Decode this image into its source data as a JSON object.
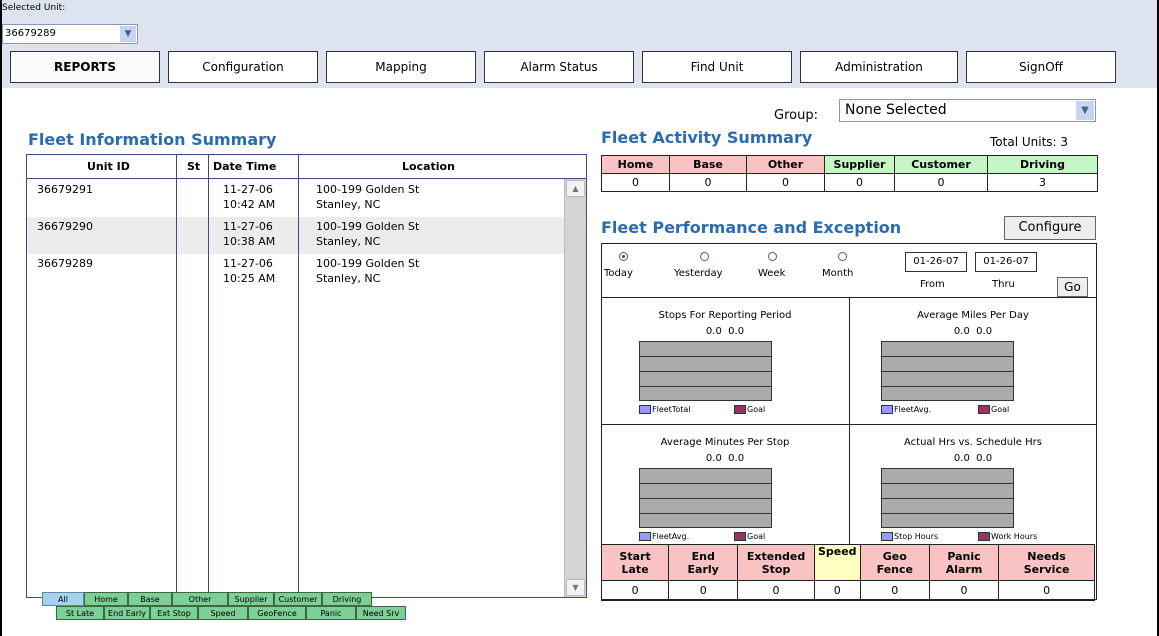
{
  "header": {
    "selected_unit_label": "Selected Unit:",
    "selected_unit_value": "36679289",
    "nav_tabs": [
      "REPORTS",
      "Configuration",
      "Mapping",
      "Alarm Status",
      "Find Unit",
      "Administration",
      "SignOff"
    ],
    "active_tab": "REPORTS"
  },
  "fleet_info": {
    "title": "Fleet Information Summary",
    "columns": [
      "Unit ID",
      "St",
      "Date Time",
      "Location"
    ],
    "rows": [
      {
        "unit_id": "36679291",
        "st": "",
        "date": "11-27-06",
        "time": "10:42 AM",
        "location_1": "100-199 Golden St",
        "location_2": "Stanley, NC"
      },
      {
        "unit_id": "36679290",
        "st": "",
        "date": "11-27-06",
        "time": "10:38 AM",
        "location_1": "100-199 Golden St",
        "location_2": "Stanley, NC"
      },
      {
        "unit_id": "36679289",
        "st": "",
        "date": "11-27-06",
        "time": "10:25 AM",
        "location_1": "100-199 Golden St",
        "location_2": "Stanley, NC"
      }
    ],
    "filter_tabs_row1": [
      "All",
      "Home",
      "Base",
      "Other",
      "Supplier",
      "Customer",
      "Driving"
    ],
    "filter_tabs_row2": [
      "St Late",
      "End Early",
      "Ext Stop",
      "Speed",
      "GeoFence",
      "Panic",
      "Need Srv"
    ],
    "active_filter": "All"
  },
  "group": {
    "label": "Group:",
    "value": "None Selected"
  },
  "activity": {
    "title": "Fleet Activity Summary",
    "total_units": "Total Units: 3",
    "headers": [
      "Home",
      "Base",
      "Other",
      "Supplier",
      "Customer",
      "Driving"
    ],
    "values": [
      "0",
      "0",
      "0",
      "0",
      "0",
      "3"
    ]
  },
  "performance": {
    "title": "Fleet Performance and Exception",
    "configure_label": "Configure",
    "periods": [
      "Today",
      "Yesterday",
      "Week",
      "Month"
    ],
    "selected_period": "Today",
    "from_date": "01-26-07",
    "thru_date": "01-26-07",
    "from_label": "From",
    "thru_label": "Thru",
    "go_label": "Go",
    "charts": [
      {
        "title": "Stops For Reporting Period",
        "v1": "0.0",
        "v2": "0.0",
        "legend1": "FleetTotal",
        "legend2": "Goal"
      },
      {
        "title": "Average Miles Per Day",
        "v1": "0.0",
        "v2": "0.0",
        "legend1": "FleetAvg.",
        "legend2": "Goal"
      },
      {
        "title": "Average Minutes Per Stop",
        "v1": "0.0",
        "v2": "0.0",
        "legend1": "FleetAvg.",
        "legend2": "Goal"
      },
      {
        "title": "Actual Hrs vs. Schedule Hrs",
        "v1": "0.0",
        "v2": "0.0",
        "legend1": "Stop Hours",
        "legend2": "Work Hours"
      }
    ],
    "legend_colors": {
      "primary": "#9999ff",
      "secondary": "#993366"
    },
    "exceptions": {
      "headers": [
        [
          "Start",
          "Late"
        ],
        [
          "End",
          "Early"
        ],
        [
          "Extended",
          "Stop"
        ],
        [
          "Speed",
          ""
        ],
        [
          "Geo",
          "Fence"
        ],
        [
          "Panic",
          "Alarm"
        ],
        [
          "Needs",
          "Service"
        ]
      ],
      "values": [
        "0",
        "0",
        "0",
        "0",
        "0",
        "0",
        "0"
      ]
    }
  }
}
